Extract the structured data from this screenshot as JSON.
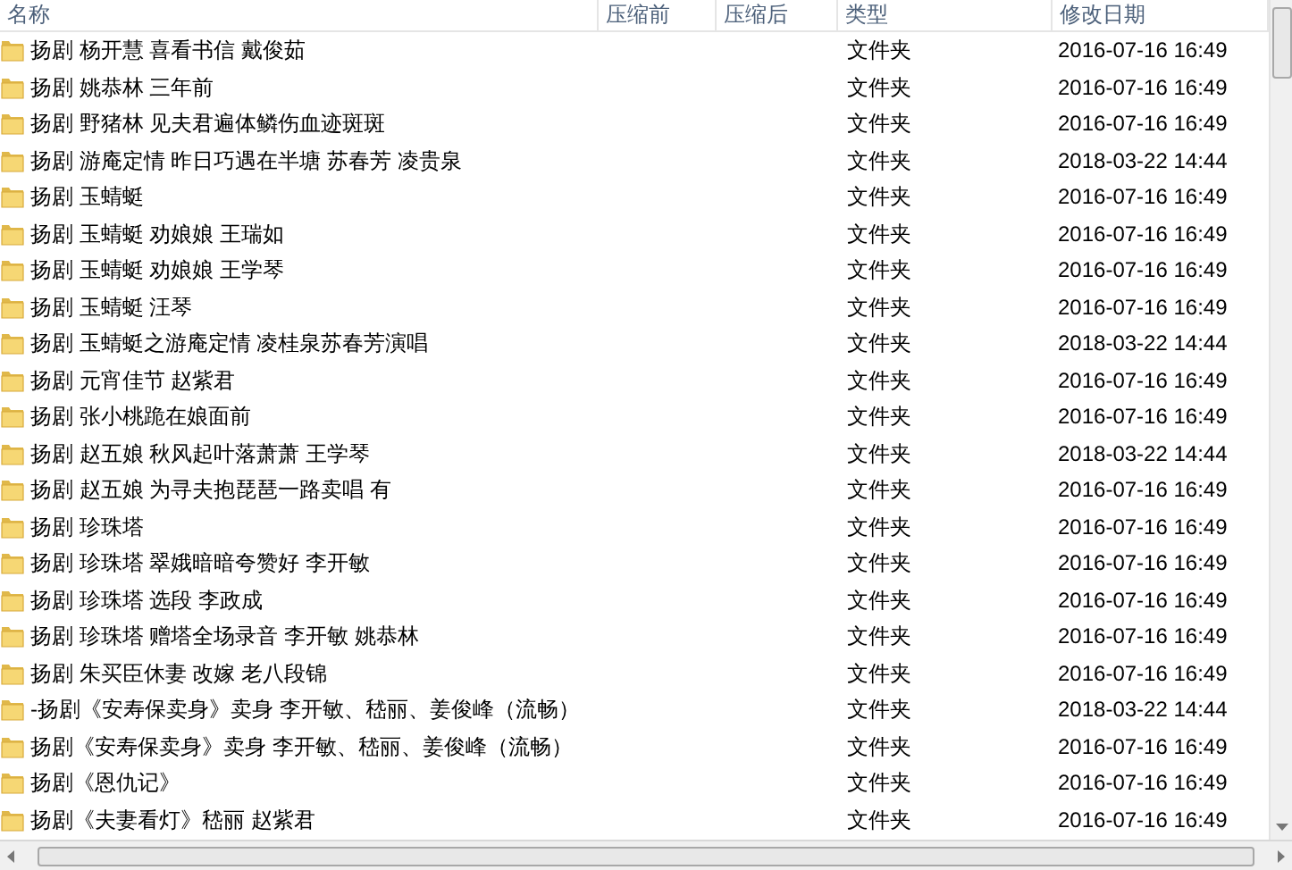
{
  "columns": [
    "名称",
    "压缩前",
    "压缩后",
    "类型",
    "修改日期"
  ],
  "rows": [
    {
      "name": "扬剧 杨开慧 喜看书信 戴俊茹",
      "type": "文件夹",
      "modified": "2016-07-16 16:49"
    },
    {
      "name": "扬剧 姚恭林 三年前",
      "type": "文件夹",
      "modified": "2016-07-16 16:49"
    },
    {
      "name": "扬剧 野猪林 见夫君遍体鳞伤血迹斑斑",
      "type": "文件夹",
      "modified": "2016-07-16 16:49"
    },
    {
      "name": "扬剧 游庵定情 昨日巧遇在半塘 苏春芳 凌贵泉",
      "type": "文件夹",
      "modified": "2018-03-22 14:44"
    },
    {
      "name": "扬剧 玉蜻蜓",
      "type": "文件夹",
      "modified": "2016-07-16 16:49"
    },
    {
      "name": "扬剧 玉蜻蜓 劝娘娘 王瑞如",
      "type": "文件夹",
      "modified": "2016-07-16 16:49"
    },
    {
      "name": "扬剧 玉蜻蜓 劝娘娘 王学琴",
      "type": "文件夹",
      "modified": "2016-07-16 16:49"
    },
    {
      "name": "扬剧 玉蜻蜓 汪琴",
      "type": "文件夹",
      "modified": "2016-07-16 16:49"
    },
    {
      "name": "扬剧 玉蜻蜓之游庵定情 凌桂泉苏春芳演唱",
      "type": "文件夹",
      "modified": "2018-03-22 14:44"
    },
    {
      "name": "扬剧 元宵佳节 赵紫君",
      "type": "文件夹",
      "modified": "2016-07-16 16:49"
    },
    {
      "name": "扬剧 张小桃跪在娘面前",
      "type": "文件夹",
      "modified": "2016-07-16 16:49"
    },
    {
      "name": "扬剧 赵五娘 秋风起叶落萧萧 王学琴",
      "type": "文件夹",
      "modified": "2018-03-22 14:44"
    },
    {
      "name": "扬剧 赵五娘 为寻夫抱琵琶一路卖唱 有",
      "type": "文件夹",
      "modified": "2016-07-16 16:49"
    },
    {
      "name": "扬剧 珍珠塔",
      "type": "文件夹",
      "modified": "2016-07-16 16:49"
    },
    {
      "name": "扬剧 珍珠塔 翠娥暗暗夸赞好 李开敏",
      "type": "文件夹",
      "modified": "2016-07-16 16:49"
    },
    {
      "name": "扬剧 珍珠塔 选段 李政成",
      "type": "文件夹",
      "modified": "2016-07-16 16:49"
    },
    {
      "name": "扬剧 珍珠塔 赠塔全场录音 李开敏 姚恭林",
      "type": "文件夹",
      "modified": "2016-07-16 16:49"
    },
    {
      "name": "扬剧 朱买臣休妻 改嫁 老八段锦",
      "type": "文件夹",
      "modified": "2016-07-16 16:49"
    },
    {
      "name": "-扬剧《安寿保卖身》卖身  李开敏、嵇丽、姜俊峰（流畅）",
      "type": "文件夹",
      "modified": "2018-03-22 14:44"
    },
    {
      "name": "扬剧《安寿保卖身》卖身  李开敏、嵇丽、姜俊峰（流畅）",
      "type": "文件夹",
      "modified": "2016-07-16 16:49"
    },
    {
      "name": "扬剧《恩仇记》",
      "type": "文件夹",
      "modified": "2016-07-16 16:49"
    },
    {
      "name": "扬剧《夫妻看灯》嵇丽 赵紫君",
      "type": "文件夹",
      "modified": "2016-07-16 16:49"
    }
  ]
}
